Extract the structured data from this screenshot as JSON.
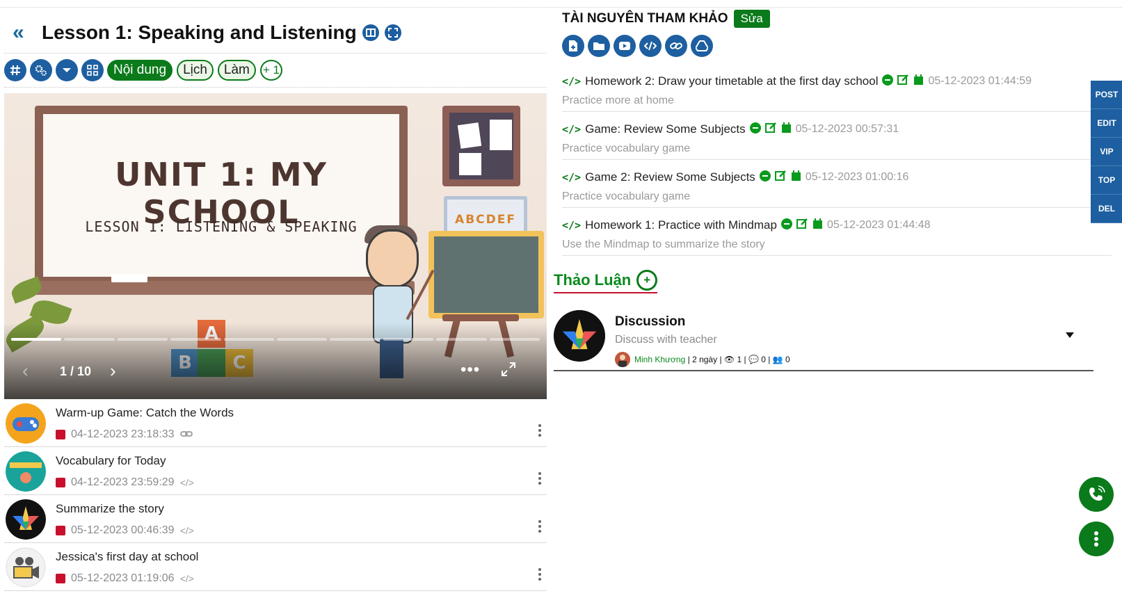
{
  "lesson": {
    "title": "Lesson 1: Speaking and Listening"
  },
  "toolbar": {
    "tab_content": "Nội dung",
    "tab_schedule": "Lịch",
    "tab_do": "Làm",
    "add_count": "+ 1"
  },
  "slide": {
    "title": "UNIT 1: MY SCHOOL",
    "subtitle": "LESSON 1: LISTENING & SPEAKING",
    "counter": "1 / 10",
    "current": 1,
    "total": 10,
    "board_letters": "ABCDEF",
    "block_a": "A",
    "block_b": "B",
    "block_c": "C"
  },
  "activities": [
    {
      "title": "Warm-up Game: Catch the Words",
      "date": "04-12-2023 23:18:33",
      "type_icon": "link-icon"
    },
    {
      "title": "Vocabulary for Today",
      "date": "04-12-2023 23:59:29",
      "type_icon": "code-icon"
    },
    {
      "title": "Summarize the story",
      "date": "05-12-2023 00:46:39",
      "type_icon": "code-icon"
    },
    {
      "title": "Jessica's first day at school",
      "date": "05-12-2023 01:19:06",
      "type_icon": "code-icon"
    }
  ],
  "resources": {
    "title": "TÀI NGUYÊN THAM KHẢO",
    "edit_label": "Sửa",
    "items": [
      {
        "title": "Homework 2: Draw your timetable at the first day school",
        "date": "05-12-2023 01:44:59",
        "desc": "Practice more at home"
      },
      {
        "title": "Game: Review Some Subjects",
        "date": "05-12-2023 00:57:31",
        "desc": "Practice vocabulary game"
      },
      {
        "title": "Game 2: Review Some Subjects",
        "date": "05-12-2023 01:00:16",
        "desc": "Practice vocabulary game"
      },
      {
        "title": "Homework 1: Practice with Mindmap",
        "date": "05-12-2023 01:44:48",
        "desc": "Use the Mindmap to summarize the story"
      }
    ]
  },
  "discussion": {
    "heading": "Thảo Luận",
    "name": "Discussion",
    "subtitle": "Discuss with teacher",
    "author": "Minh Khương",
    "time": "2 ngày",
    "views": "1",
    "comments": "0",
    "members": "0"
  },
  "side_tabs": [
    "POST",
    "EDIT",
    "VIP",
    "TOP",
    "DEL"
  ],
  "colors": {
    "primary_blue": "#1d5fa0",
    "brand_green": "#0a7a1a",
    "date_red": "#c8102e"
  }
}
